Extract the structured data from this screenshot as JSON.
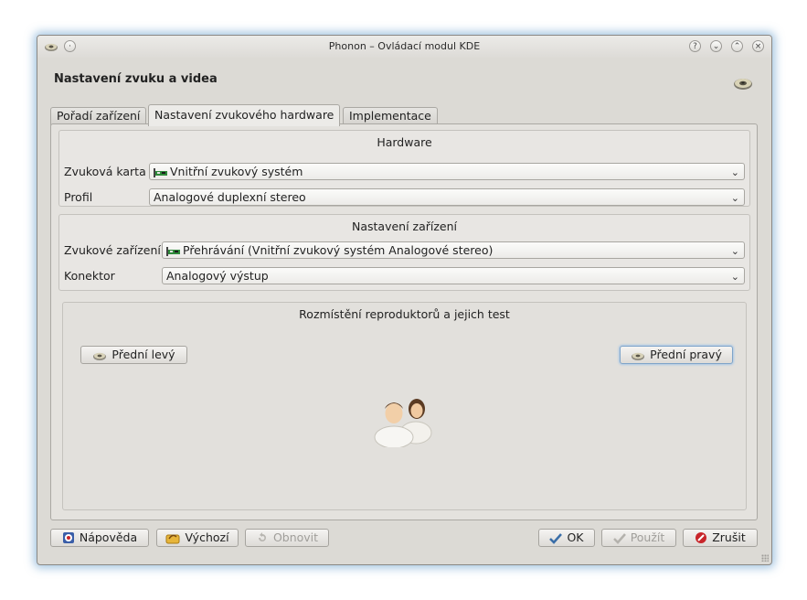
{
  "window": {
    "title": "Phonon – Ovládací modul KDE",
    "controls": [
      "help-icon",
      "minimize-icon",
      "maximize-icon",
      "close-icon"
    ]
  },
  "header": {
    "title": "Nastavení zvuku a videa"
  },
  "tabs": [
    {
      "label": "Pořadí zařízení",
      "active": false
    },
    {
      "label": "Nastavení zvukového hardware",
      "active": true
    },
    {
      "label": "Implementace",
      "active": false
    }
  ],
  "hardware": {
    "title": "Hardware",
    "sound_card_label": "Zvuková karta",
    "sound_card_value": "Vnitřní zvukový systém",
    "profile_label": "Profil",
    "profile_value": "Analogové duplexní stereo"
  },
  "device": {
    "title": "Nastavení zařízení",
    "sound_device_label": "Zvukové zařízení",
    "sound_device_value": "Přehrávání (Vnitřní zvukový systém Analogové stereo)",
    "connector_label": "Konektor",
    "connector_value": "Analogový výstup"
  },
  "speakers": {
    "title": "Rozmístění reproduktorů a jejich test",
    "front_left": "Přední levý",
    "front_right": "Přední pravý"
  },
  "buttons": {
    "help": "Nápověda",
    "defaults": "Výchozí",
    "reset": "Obnovit",
    "ok": "OK",
    "apply": "Použít",
    "cancel": "Zrušit"
  },
  "colors": {
    "window_bg": "#dcdad5",
    "focus_ring": "#7ea4c9",
    "cancel_red": "#c8252a",
    "ok_blue": "#3a6ea8"
  }
}
